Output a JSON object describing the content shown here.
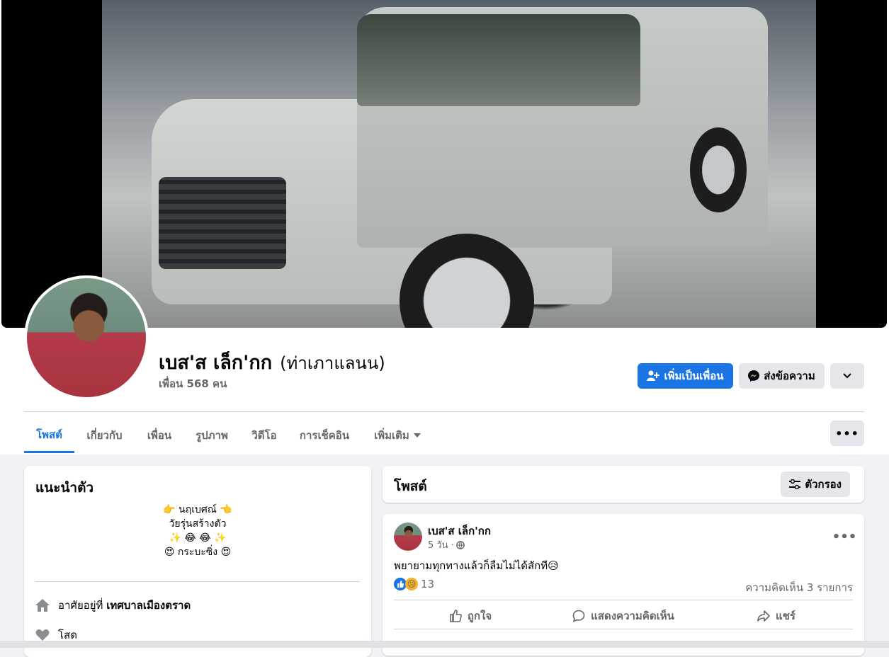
{
  "profile": {
    "name": "เบส'ส เล็ก'กก",
    "alt_name": "(ท่าเภาแลนน)",
    "friends": "เพื่อน 568 คน"
  },
  "actions": {
    "add_friend": "เพิ่มเป็นเพื่อน",
    "message": "ส่งข้อความ"
  },
  "tabs": [
    {
      "label": "โพสต์",
      "active": true
    },
    {
      "label": "เกี่ยวกับ"
    },
    {
      "label": "เพื่อน"
    },
    {
      "label": "รูปภาพ"
    },
    {
      "label": "วิดีโอ"
    },
    {
      "label": "การเช็คอิน"
    },
    {
      "label": "เพิ่มเติม"
    }
  ],
  "intro": {
    "title": "แนะนำตัว",
    "bio_lines": [
      "👉 นฤเบศณ์ 👈",
      "วัยรุ่นสร้างตัว",
      "✨ 😂 😂 ✨",
      "😍 กระบะซิ่ง 😍"
    ],
    "lives_prefix": "อาศัยอยู่ที่",
    "lives_place": "เทศบาลเมืองตราด",
    "relationship": "โสด"
  },
  "posts_section": {
    "title": "โพสต์",
    "filter_label": "ตัวกรอง"
  },
  "post": {
    "author": "เบส'ส เล็ก'กก",
    "time": "5 วัน ·",
    "text": "พยายามทุกทางแล้วก็ลืมไม่ได้สักที😥",
    "reaction_count": "13",
    "comments": "ความคิดเห็น 3 รายการ",
    "like_label": "ถูกใจ",
    "comment_label": "แสดงความคิดเห็น",
    "share_label": "แชร์"
  },
  "colors": {
    "accent": "#1b74e4",
    "secondary_button": "#e4e6eb",
    "page_background": "#f0f2f5",
    "muted_text": "#65676b"
  }
}
